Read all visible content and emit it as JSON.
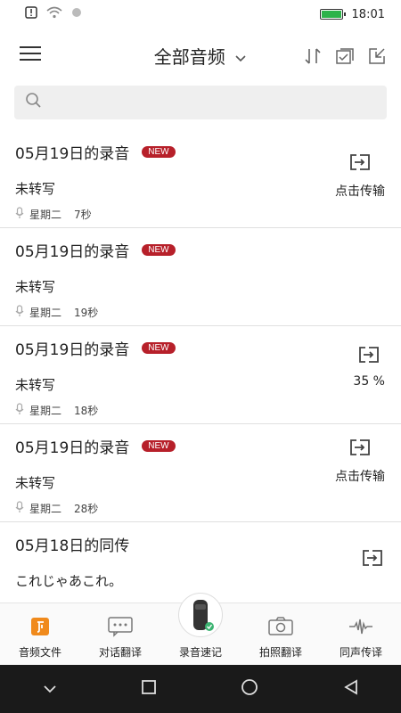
{
  "status_bar": {
    "time": "18:01"
  },
  "header": {
    "title": "全部音频"
  },
  "search": {
    "placeholder": ""
  },
  "recordings": [
    {
      "title": "05月19日的录音",
      "badge": "NEW",
      "status": "未转写",
      "day": "星期二",
      "duration": "7秒",
      "action": "点击传输"
    },
    {
      "title": "05月19日的录音",
      "badge": "NEW",
      "status": "未转写",
      "day": "星期二",
      "duration": "19秒",
      "action": ""
    },
    {
      "title": "05月19日的录音",
      "badge": "NEW",
      "status": "未转写",
      "day": "星期二",
      "duration": "18秒",
      "action": "35 %"
    },
    {
      "title": "05月19日的录音",
      "badge": "NEW",
      "status": "未转写",
      "day": "星期二",
      "duration": "28秒",
      "action": "点击传输"
    },
    {
      "title": "05月18日的同传",
      "badge": "",
      "status": "これじゃあこれ。",
      "day": "",
      "duration": "",
      "action": ""
    }
  ],
  "tabs": [
    {
      "label": "音频文件",
      "icon": "audio-file-icon",
      "active": true
    },
    {
      "label": "对话翻译",
      "icon": "dialogue-icon",
      "active": false
    },
    {
      "label": "录音速记",
      "icon": "recorder-device-icon",
      "active": false
    },
    {
      "label": "拍照翻译",
      "icon": "camera-icon",
      "active": false
    },
    {
      "label": "同声传译",
      "icon": "waveform-icon",
      "active": false
    }
  ],
  "colors": {
    "accent": "#b7202a",
    "active_tab": "#f08a1c",
    "battery": "#2db34a"
  }
}
